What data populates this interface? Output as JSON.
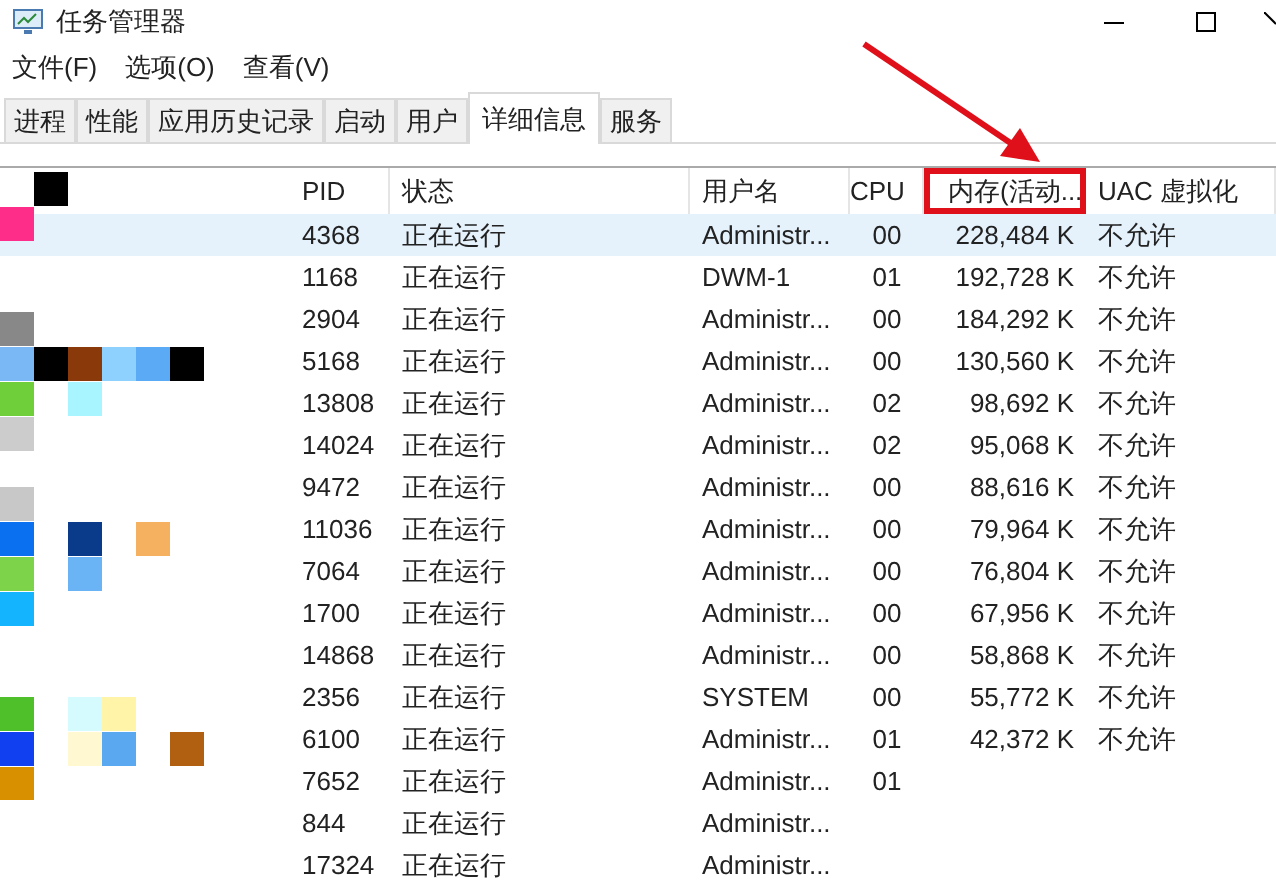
{
  "window": {
    "title": "任务管理器"
  },
  "menu": [
    "文件(F)",
    "选项(O)",
    "查看(V)"
  ],
  "tabs": [
    {
      "label": "进程",
      "selected": false
    },
    {
      "label": "性能",
      "selected": false
    },
    {
      "label": "应用历史记录",
      "selected": false
    },
    {
      "label": "启动",
      "selected": false
    },
    {
      "label": "用户",
      "selected": false
    },
    {
      "label": "详细信息",
      "selected": true
    },
    {
      "label": "服务",
      "selected": false
    }
  ],
  "table": {
    "columns": [
      {
        "label": "PID",
        "highlighted": false
      },
      {
        "label": "状态",
        "highlighted": false
      },
      {
        "label": "用户名",
        "highlighted": false
      },
      {
        "label": "CPU",
        "highlighted": false
      },
      {
        "label": "内存(活动...",
        "highlighted": true
      },
      {
        "label": "UAC 虚拟化",
        "highlighted": false
      }
    ],
    "rows": [
      {
        "selected": true,
        "cells": [
          "4368",
          "正在运行",
          "Administr...",
          "00",
          "228,484 K",
          "不允许"
        ]
      },
      {
        "selected": false,
        "cells": [
          "1168",
          "正在运行",
          "DWM-1",
          "01",
          "192,728 K",
          "不允许"
        ]
      },
      {
        "selected": false,
        "cells": [
          "2904",
          "正在运行",
          "Administr...",
          "00",
          "184,292 K",
          "不允许"
        ]
      },
      {
        "selected": false,
        "cells": [
          "5168",
          "正在运行",
          "Administr...",
          "00",
          "130,560 K",
          "不允许"
        ]
      },
      {
        "selected": false,
        "cells": [
          "13808",
          "正在运行",
          "Administr...",
          "02",
          "98,692 K",
          "不允许"
        ]
      },
      {
        "selected": false,
        "cells": [
          "14024",
          "正在运行",
          "Administr...",
          "02",
          "95,068 K",
          "不允许"
        ]
      },
      {
        "selected": false,
        "cells": [
          "9472",
          "正在运行",
          "Administr...",
          "00",
          "88,616 K",
          "不允许"
        ]
      },
      {
        "selected": false,
        "cells": [
          "11036",
          "正在运行",
          "Administr...",
          "00",
          "79,964 K",
          "不允许"
        ]
      },
      {
        "selected": false,
        "cells": [
          "7064",
          "正在运行",
          "Administr...",
          "00",
          "76,804 K",
          "不允许"
        ]
      },
      {
        "selected": false,
        "cells": [
          "1700",
          "正在运行",
          "Administr...",
          "00",
          "67,956 K",
          "不允许"
        ]
      },
      {
        "selected": false,
        "cells": [
          "14868",
          "正在运行",
          "Administr...",
          "00",
          "58,868 K",
          "不允许"
        ]
      },
      {
        "selected": false,
        "cells": [
          "2356",
          "正在运行",
          "SYSTEM",
          "00",
          "55,772 K",
          "不允许"
        ]
      },
      {
        "selected": false,
        "cells": [
          "6100",
          "正在运行",
          "Administr...",
          "01",
          "42,372 K",
          "不允许"
        ]
      },
      {
        "selected": false,
        "cells": [
          "7652",
          "正在运行",
          "Administr...",
          "01"
        ]
      },
      {
        "selected": false,
        "cells": [
          "844",
          "正在运行",
          "Administr..."
        ]
      },
      {
        "selected": false,
        "cells": [
          "17324",
          "正在运行",
          "Administr..."
        ]
      }
    ]
  }
}
